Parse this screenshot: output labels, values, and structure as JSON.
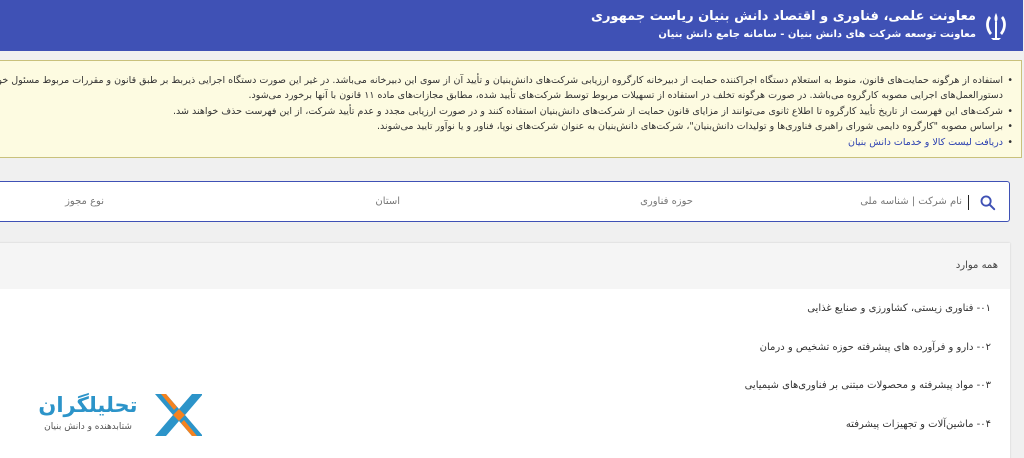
{
  "header": {
    "title": "معاونت علمی، فناوری و اقتصاد دانش بنیان ریاست جمهوری",
    "subtitle": "معاونت توسعه شرکت های دانش بنیان - سامانه جامع دانش بنیان"
  },
  "notice": {
    "lines": [
      "استفاده از هرگونه حمایت‌های قانون، منوط به استعلام دستگاه اجراکننده حمایت از دبیرخانه کارگروه ارزیابی شرکت‌های دانش‌بنیان و تأیید آن از سوی این دبیرخانه می‌باشد. در غیر این صورت دستگاه اجرایی ذیربط بر طبق قانون و مقررات مربوط مسئول خواهد بود.",
      "دستورالعمل‌های اجرایی مصوبه کارگروه می‌باشد. در صورت هرگونه تخلف در استفاده از تسهیلات مربوط توسط شرکت‌های تأیید شده، مطابق مجازات‌های ماده ۱۱ قانون با آنها برخورد می‌شود.",
      "شرکت‌های این فهرست از تاریخ تأیید کارگروه تا اطلاع ثانوی می‌توانند از مزایای قانون حمایت از شرکت‌های دانش‌بنیان استفاده کنند و در صورت ارزیابی مجدد و عدم تأیید شرکت، از این فهرست حذف خواهند شد.",
      "براساس مصوبه \"کارگروه دایمی شورای راهبری فناوری‌ها و تولیدات دانش‌بنیان\"، شرکت‌های دانش‌بنیان به عنوان شرکت‌های نوپا، فناور و یا نوآور تایید می‌شوند."
    ],
    "link": "دریافت لیست کالا و خدمات دانش بنیان"
  },
  "filters": {
    "search_placeholder": "نام شرکت | شناسه ملی",
    "tech_field": "حوزه فناوری",
    "province": "استان",
    "license_type": "نوع مجوز"
  },
  "list": {
    "header": "همه موارد",
    "items": [
      "۰۱- فناوری زیستی، کشاورزی و صنایع غذایی",
      "۰۲- دارو و فرآورده های پیشرفته حوزه تشخیص و درمان",
      "۰۳- مواد پیشرفته و محصولات مبتنی بر فناوری‌های شیمیایی",
      "۰۴- ماشین‌آلات و تجهیزات پیشرفته"
    ]
  },
  "watermark": {
    "name": "تحلیلگران",
    "tagline": "شتابدهنده و دانش بنیان"
  },
  "colors": {
    "header_bg": "#3f51b5",
    "notice_bg": "#fdfbe1",
    "link": "#2a3fb0",
    "logo_blue": "#2c94c9",
    "logo_orange": "#f5821f"
  }
}
